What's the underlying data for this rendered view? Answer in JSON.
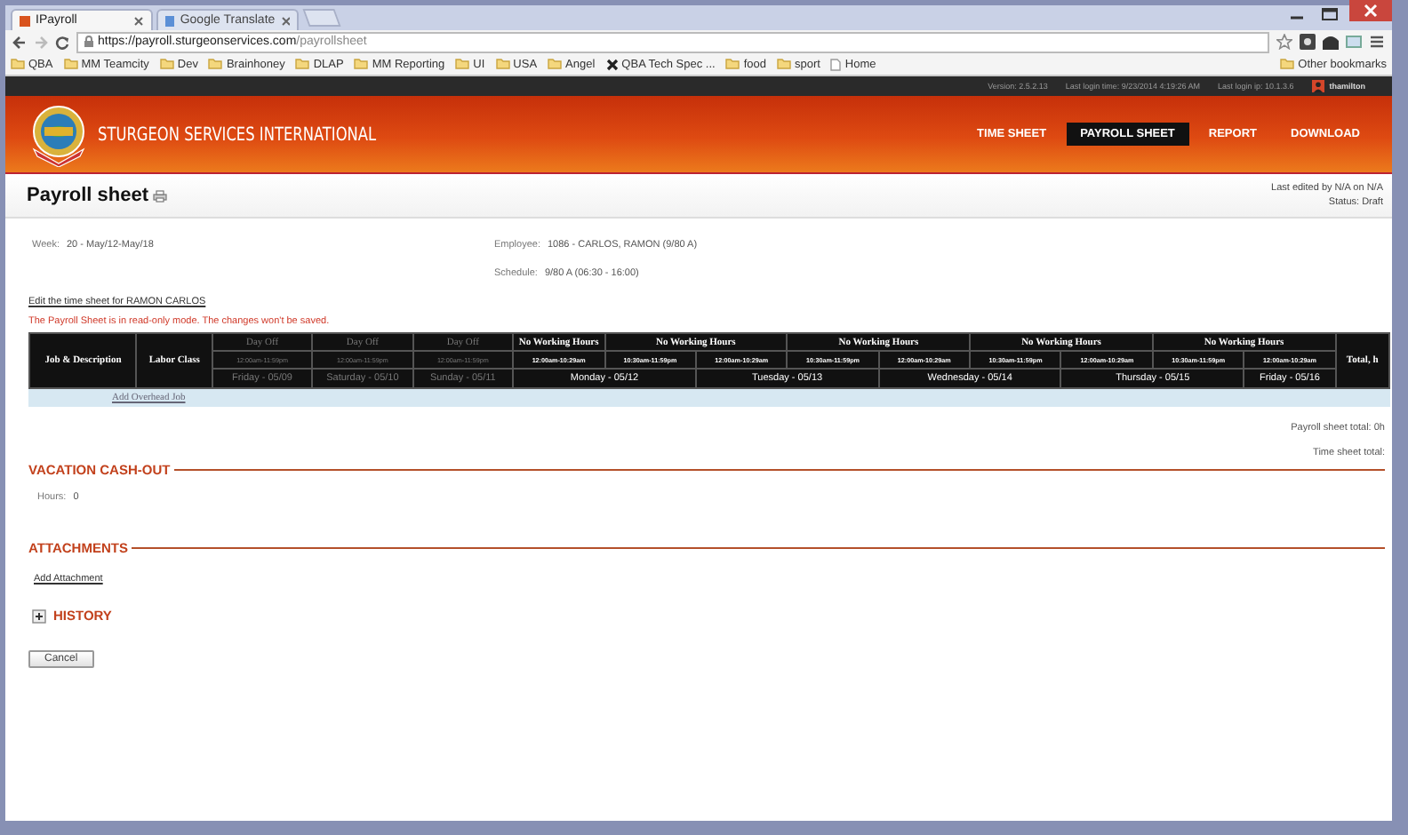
{
  "browser": {
    "tabs": [
      {
        "label": "IPayroll",
        "selected": true
      },
      {
        "label": "Google Translate",
        "selected": false
      }
    ],
    "url": {
      "host": "https://payroll.sturgeonservices.com",
      "path": "/payrollsheet"
    },
    "bookmarks": [
      {
        "label": "QBA",
        "kind": "folder"
      },
      {
        "label": "MM Teamcity",
        "kind": "folder"
      },
      {
        "label": "Dev",
        "kind": "folder"
      },
      {
        "label": "Brainhoney",
        "kind": "folder"
      },
      {
        "label": "DLAP",
        "kind": "folder"
      },
      {
        "label": "MM Reporting",
        "kind": "folder"
      },
      {
        "label": "UI",
        "kind": "folder"
      },
      {
        "label": "USA",
        "kind": "folder"
      },
      {
        "label": "Angel",
        "kind": "folder"
      },
      {
        "label": "QBA Tech Spec ...",
        "kind": "site"
      },
      {
        "label": "food",
        "kind": "folder"
      },
      {
        "label": "sport",
        "kind": "folder"
      },
      {
        "label": "Home",
        "kind": "page"
      }
    ],
    "other_bookmarks": "Other bookmarks"
  },
  "top_bar": {
    "version": "Version: 2.5.2.13",
    "last_login_time": "Last login time: 9/23/2014 4:19:26 AM",
    "last_login_ip": "Last login ip: 10.1.3.6",
    "user": "thamilton"
  },
  "header": {
    "brand": "STURGEON SERVICES INTERNATIONAL",
    "nav": [
      {
        "label": "TIME SHEET",
        "selected": false
      },
      {
        "label": "PAYROLL SHEET",
        "selected": true
      },
      {
        "label": "REPORT",
        "selected": false
      },
      {
        "label": "DOWNLOAD",
        "selected": false
      }
    ]
  },
  "page": {
    "title": "Payroll sheet",
    "last_edited": "Last edited by N/A  on N/A",
    "status": "Status: Draft"
  },
  "info": {
    "week_label": "Week:",
    "week": "20 - May/12-May/18",
    "employee_label": "Employee:",
    "employee": "1086 - CARLOS, RAMON (9/80 A)",
    "schedule_label": "Schedule:",
    "schedule": "9/80 A (06:30 - 16:00)"
  },
  "edit_link": "Edit the time sheet for RAMON CARLOS",
  "warning": "The Payroll Sheet is in read-only mode. The changes won't be saved.",
  "table": {
    "columns": [
      "Job & Description",
      "Labor Class"
    ],
    "total_column": "Total, h",
    "header_groups": [
      {
        "label": "Day Off",
        "kind": "off"
      },
      {
        "label": "Day Off",
        "kind": "off"
      },
      {
        "label": "Day Off",
        "kind": "off"
      },
      {
        "label": "No Working Hours",
        "kind": "work"
      },
      {
        "label": "No Working Hours",
        "kind": "work"
      },
      {
        "label": "No Working Hours",
        "kind": "work"
      },
      {
        "label": "No Working Hours",
        "kind": "work"
      },
      {
        "label": "No Working Hours",
        "kind": "work"
      }
    ],
    "days": [
      {
        "label": "Friday - 05/09",
        "kind": "off",
        "times": [
          "12:00am-11:59pm"
        ]
      },
      {
        "label": "Saturday - 05/10",
        "kind": "off",
        "times": [
          "12:00am-11:59pm"
        ]
      },
      {
        "label": "Sunday - 05/11",
        "kind": "off",
        "times": [
          "12:00am-11:59pm"
        ]
      },
      {
        "label": "Monday - 05/12",
        "kind": "work",
        "times": [
          "12:00am-10:29am",
          "10:30am-11:59pm"
        ]
      },
      {
        "label": "Tuesday - 05/13",
        "kind": "work",
        "times": [
          "12:00am-10:29am",
          "10:30am-11:59pm"
        ]
      },
      {
        "label": "Wednesday - 05/14",
        "kind": "work",
        "times": [
          "12:00am-10:29am",
          "10:30am-11:59pm"
        ]
      },
      {
        "label": "Thursday - 05/15",
        "kind": "work",
        "times": [
          "12:00am-10:29am",
          "10:30am-11:59pm"
        ]
      },
      {
        "label": "Friday - 05/16",
        "kind": "work",
        "times": [
          "12:00am-10:29am"
        ]
      }
    ],
    "add_link": "Add Overhead Job"
  },
  "totals": [
    "Payroll sheet total: 0h",
    "Time sheet total:"
  ],
  "vacation": {
    "title": "VACATION CASH-OUT",
    "hours_label": "Hours:",
    "hours": "0"
  },
  "attachments": {
    "title": "ATTACHMENTS",
    "add_link": "Add Attachment"
  },
  "history": {
    "title": "HISTORY",
    "expanded": false
  },
  "cancel": "Cancel"
}
